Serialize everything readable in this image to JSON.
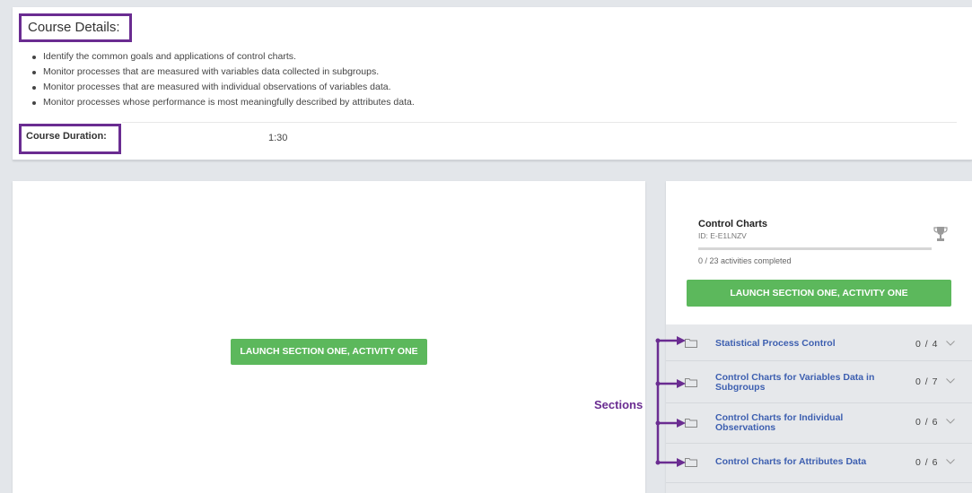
{
  "course_details": {
    "title": "Course Details:",
    "bullets": [
      "Identify the common goals and applications of control charts.",
      "Monitor processes that are measured with variables data collected in subgroups.",
      "Monitor processes that are measured with individual observations of variables data.",
      "Monitor processes whose performance is most meaningfully described by attributes data."
    ],
    "duration_label": "Course Duration:",
    "duration_value": "1:30"
  },
  "main_panel": {
    "launch_label": "LAUNCH SECTION ONE, ACTIVITY ONE"
  },
  "course_card": {
    "name": "Control Charts",
    "id_text": "ID: E-E1LNZV",
    "progress_fraction": 0,
    "progress_text": "0 / 23 activities completed",
    "launch_label": "LAUNCH SECTION ONE, ACTIVITY ONE",
    "trophy_icon": "trophy-icon"
  },
  "sections": [
    {
      "title": "Statistical Process Control",
      "count": "0 / 4"
    },
    {
      "title": "Control Charts for Variables Data in Subgroups",
      "count": "0 / 7"
    },
    {
      "title": "Control Charts for Individual Observations",
      "count": "0 / 6"
    },
    {
      "title": "Control Charts for Attributes Data",
      "count": "0 / 6"
    }
  ],
  "annotation": {
    "sections_label": "Sections",
    "color": "#6a2c91"
  },
  "colors": {
    "accent_green": "#5cb85c",
    "link_blue": "#3d5fb0",
    "annotation_purple": "#6a2c91"
  }
}
